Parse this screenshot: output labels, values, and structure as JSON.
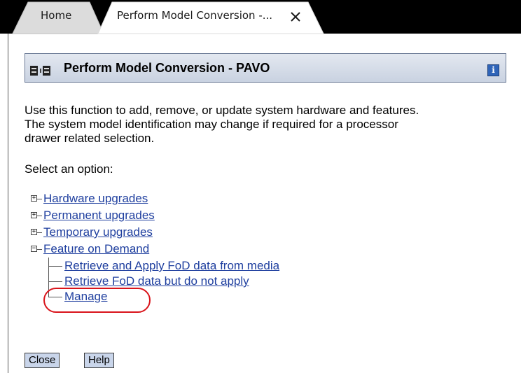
{
  "tabs": [
    {
      "label": "Home"
    },
    {
      "label": "Perform Model Conversion -..."
    }
  ],
  "dialog": {
    "title": "Perform Model Conversion - PAVO",
    "info_icon": "i",
    "description": [
      "Use this function to add, remove, or update system hardware and features.",
      "The system model identification may change if required for a processor",
      "drawer related selection."
    ],
    "select_label": "Select an option:"
  },
  "tree": {
    "hardware_upgrades": "Hardware upgrades",
    "permanent_upgrades": "Permanent upgrades",
    "temporary_upgrades": "Temporary upgrades",
    "feature_on_demand": "Feature on Demand",
    "fod_children": [
      "Retrieve and Apply FoD data from media",
      "Retrieve FoD data but do not apply",
      "Manage"
    ]
  },
  "buttons": {
    "close": "Close",
    "help": "Help"
  },
  "colors": {
    "link": "#1f3f9f",
    "highlight": "#d9141b",
    "tabbar": "#000000"
  }
}
